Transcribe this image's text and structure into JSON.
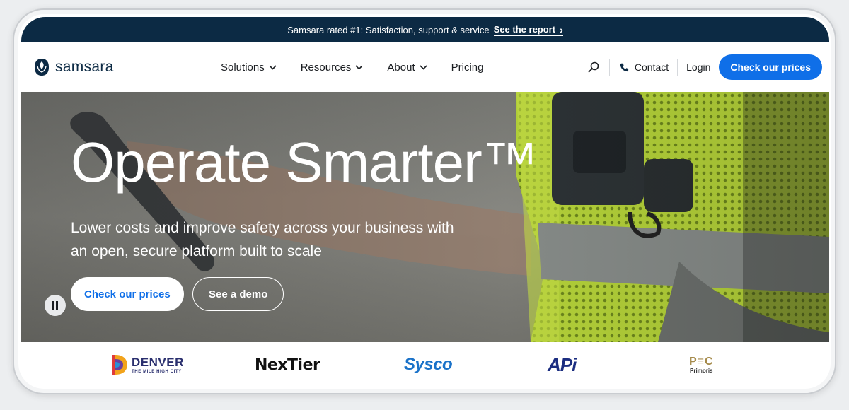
{
  "announcement": {
    "text": "Samsara rated #1: Satisfaction, support & service",
    "link_label": "See the report",
    "chevron": "›"
  },
  "brand": {
    "name": "samsara",
    "logo_icon": "samsara-mark-icon",
    "color": "#0c2a44"
  },
  "nav": {
    "items": [
      {
        "label": "Solutions",
        "has_dropdown": true
      },
      {
        "label": "Resources",
        "has_dropdown": true
      },
      {
        "label": "About",
        "has_dropdown": true
      },
      {
        "label": "Pricing",
        "has_dropdown": false
      }
    ],
    "contact_label": "Contact",
    "login_label": "Login",
    "cta_label": "Check our prices"
  },
  "hero": {
    "title": "Operate Smarter™",
    "subtitle": "Lower costs and improve safety across your business with an open, secure platform built to scale",
    "primary_button": "Check our prices",
    "secondary_button": "See a demo",
    "pause_icon": "pause-icon"
  },
  "customer_logos": {
    "denver": {
      "name": "DENVER",
      "tagline": "THE MILE HIGH CITY"
    },
    "nextier": {
      "name": "NexTier"
    },
    "sysco": {
      "name": "Sysco"
    },
    "api": {
      "name": "APi"
    },
    "primoris": {
      "mark": "P≡C",
      "name": "Primoris"
    }
  },
  "colors": {
    "announce_bg": "#0c2a44",
    "accent_blue": "#0f6fe8",
    "hero_text": "#ffffff"
  }
}
